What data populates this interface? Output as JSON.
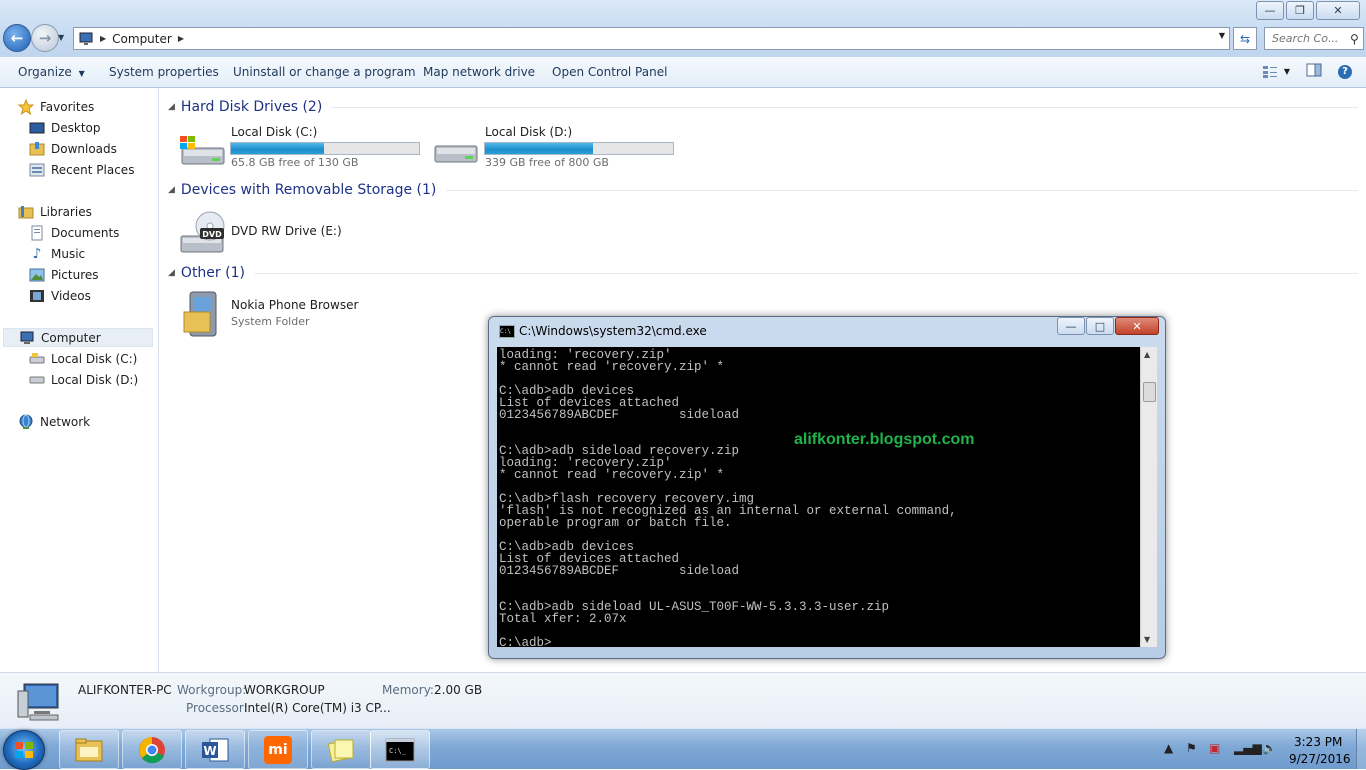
{
  "window": {
    "address": {
      "location": "Computer"
    },
    "search": {
      "placeholder": "Search Co..."
    }
  },
  "toolbar": {
    "organize_label": "Organize",
    "system_properties_label": "System properties",
    "uninstall_label": "Uninstall or change a program",
    "map_drive_label": "Map network drive",
    "control_panel_label": "Open Control Panel"
  },
  "sidebar": {
    "favorites": {
      "label": "Favorites",
      "items": [
        {
          "label": "Desktop",
          "icon": "desktop-icon"
        },
        {
          "label": "Downloads",
          "icon": "downloads-folder-icon"
        },
        {
          "label": "Recent Places",
          "icon": "recent-places-icon"
        }
      ]
    },
    "libraries": {
      "label": "Libraries",
      "items": [
        {
          "label": "Documents",
          "icon": "documents-icon"
        },
        {
          "label": "Music",
          "icon": "music-icon"
        },
        {
          "label": "Pictures",
          "icon": "pictures-icon"
        },
        {
          "label": "Videos",
          "icon": "videos-icon"
        }
      ]
    },
    "computer": {
      "label": "Computer",
      "items": [
        {
          "label": "Local Disk (C:)",
          "icon": "drive-icon"
        },
        {
          "label": "Local Disk (D:)",
          "icon": "drive-icon"
        }
      ]
    },
    "network": {
      "label": "Network"
    }
  },
  "groups": {
    "hard_disks": {
      "header": "Hard Disk Drives (2)",
      "drives": [
        {
          "name": "Local Disk (C:)",
          "free": "65.8 GB free of 130 GB",
          "used_fraction": 0.494
        },
        {
          "name": "Local Disk (D:)",
          "free": "339 GB free of 800 GB",
          "used_fraction": 0.576
        }
      ]
    },
    "removable": {
      "header": "Devices with Removable Storage (1)",
      "devices": [
        {
          "name": "DVD RW Drive (E:)",
          "badge": "DVD"
        }
      ]
    },
    "other": {
      "header": "Other (1)",
      "items": [
        {
          "name": "Nokia Phone Browser",
          "type": "System Folder"
        }
      ]
    }
  },
  "details": {
    "computer_name": "ALIFKONTER-PC",
    "workgroup_label": "Workgroup:",
    "workgroup_value": "WORKGROUP",
    "memory_label": "Memory:",
    "memory_value": "2.00 GB",
    "processor_label": "Processor:",
    "processor_value": "Intel(R) Core(TM) i3 CP..."
  },
  "cmd": {
    "title": "C:\\Windows\\system32\\cmd.exe",
    "lines": [
      "loading: 'recovery.zip'",
      "* cannot read 'recovery.zip' *",
      "",
      "C:\\adb>adb devices",
      "List of devices attached",
      "0123456789ABCDEF        sideload",
      "",
      "",
      "C:\\adb>adb sideload recovery.zip",
      "loading: 'recovery.zip'",
      "* cannot read 'recovery.zip' *",
      "",
      "C:\\adb>flash recovery recovery.img",
      "'flash' is not recognized as an internal or external command,",
      "operable program or batch file.",
      "",
      "C:\\adb>adb devices",
      "List of devices attached",
      "0123456789ABCDEF        sideload",
      "",
      "",
      "C:\\adb>adb sideload UL-ASUS_T00F-WW-5.3.3.3-user.zip",
      "Total xfer: 2.07x",
      "",
      "C:\\adb>"
    ],
    "watermark": "alifkonter.blogspot.com"
  },
  "taskbar": {
    "apps": [
      {
        "name": "explorer",
        "icon": "folder-icon"
      },
      {
        "name": "chrome",
        "icon": "chrome-icon"
      },
      {
        "name": "word",
        "icon": "word-icon"
      },
      {
        "name": "mi",
        "icon": "mi-icon",
        "text": "mi"
      },
      {
        "name": "sticky-notes",
        "icon": "sticky-notes-icon"
      },
      {
        "name": "cmd",
        "icon": "cmd-icon"
      }
    ],
    "clock": {
      "time": "3:23 PM",
      "date": "9/27/2016"
    }
  },
  "colors": {
    "group_header": "#1e3287",
    "drive_bar_fill": "#26a0dc",
    "watermark": "#21b24b"
  }
}
